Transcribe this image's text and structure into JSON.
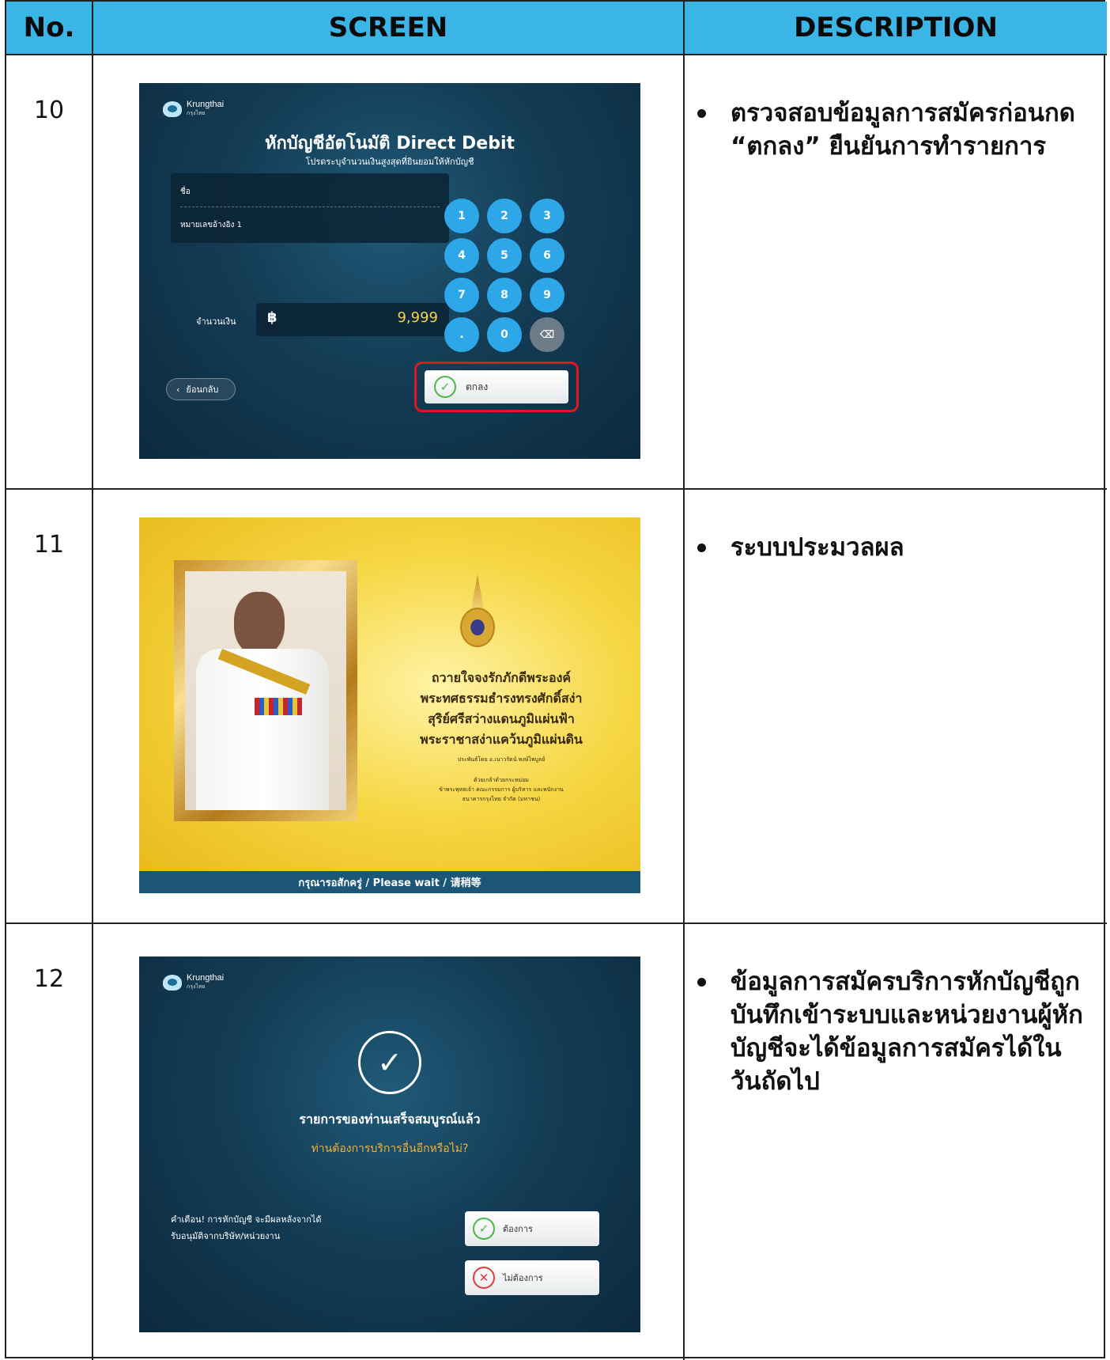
{
  "header": {
    "no": "No.",
    "screen": "SCREEN",
    "description": "DESCRIPTION"
  },
  "rows": [
    {
      "no": "10",
      "description": "ตรวจสอบข้อมูลการสมัครก่อนกด “ตกลง” ยืนยันการทำรายการ",
      "screen": {
        "logo": "Krungthai",
        "logo_sub": "กรุงไทย",
        "title": "หักบัญชีอัตโนมัติ Direct Debit",
        "subtitle": "โปรดระบุจำนวนเงินสูงสุดที่ยินยอมให้หักบัญชี",
        "name_label": "ชื่อ",
        "ref_label": "หมายเลขอ้างอิง 1",
        "amount_label": "จำนวนเงิน",
        "currency": "฿",
        "amount": "9,999",
        "keys": [
          "1",
          "2",
          "3",
          "4",
          "5",
          "6",
          "7",
          "8",
          "9",
          ".",
          "0",
          "⌫"
        ],
        "back": "ย้อนกลับ",
        "ok": "ตกลง"
      }
    },
    {
      "no": "11",
      "description": "ระบบประมวลผล",
      "screen": {
        "line1": "ถวายใจจงรักภักดีพระองค์",
        "line2": "พระทศธรรมธำรงทรงศักดิ์สง่า",
        "line3": "สุริย์ศรีสว่างแดนภูมิแผ่นฟ้า",
        "line4": "พระราชาสง่าแคว้นภูมิแผ่นดิน",
        "author": "ประพันธ์โดย อ.เนาวรัตน์ พงษ์ไพบูลย์",
        "credit1": "ด้วยเกล้าด้วยกระหม่อม",
        "credit2": "ข้าพระพุทธเจ้า คณะกรรมการ ผู้บริหาร และพนักงาน",
        "credit3": "ธนาคารกรุงไทย จำกัด (มหาชน)",
        "wait": "กรุณารอสักครู่ / Please wait / 请稍等"
      }
    },
    {
      "no": "12",
      "description": "ข้อมูลการสมัครบริการหักบัญชีถูกบันทึกเข้าระบบและหน่วยงานผู้หักบัญชีจะได้ข้อมูลการสมัครได้ในวันถัดไป",
      "screen": {
        "logo": "Krungthai",
        "logo_sub": "กรุงไทย",
        "title": "รายการของท่านเสร็จสมบูรณ์แล้ว",
        "question": "ท่านต้องการบริการอื่นอีกหรือไม่?",
        "warning_line1": "คำเตือน! การหักบัญชี จะมีผลหลังจากได้",
        "warning_line2": "รับอนุมัติจากบริษัท/หน่วยงาน",
        "yes": "ต้องการ",
        "no": "ไม่ต้องการ"
      }
    }
  ],
  "colors": {
    "header_bg": "#3ab5e6",
    "key_blue": "#2ea7e8",
    "highlight_red": "#e0171f",
    "amount_yellow": "#f3d44f",
    "question_orange": "#f0b23c"
  }
}
